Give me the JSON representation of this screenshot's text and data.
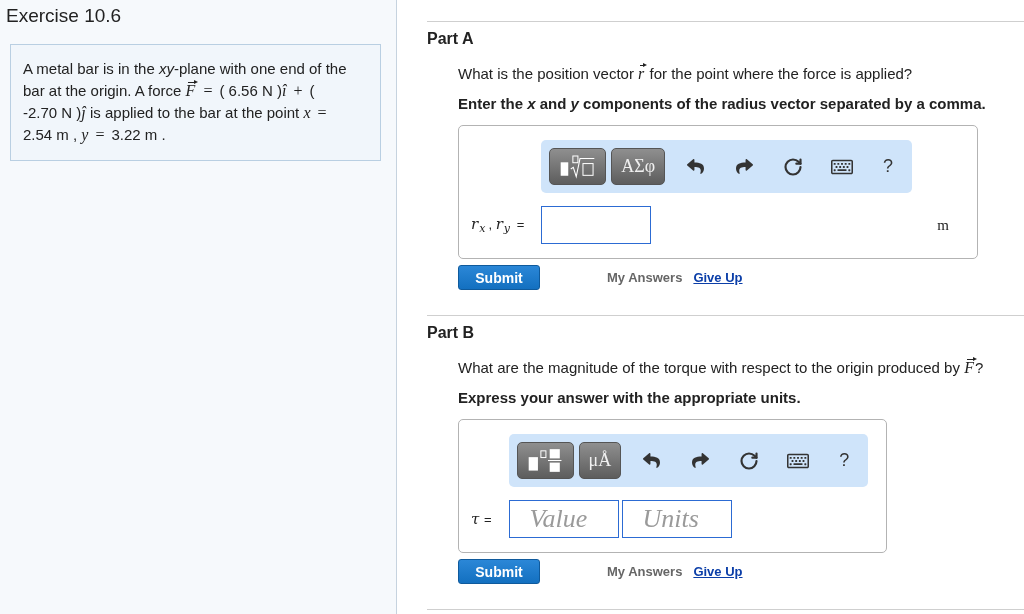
{
  "exercise": {
    "title": "Exercise 10.6",
    "problem": [
      {
        "kind": "text",
        "text": "A metal bar is in the "
      },
      {
        "kind": "italic",
        "text": "xy"
      },
      {
        "kind": "text",
        "text": "-plane with one end of the bar at the origin. A force "
      },
      {
        "kind": "vector",
        "text": "F"
      },
      {
        "kind": "operator",
        "text": " = "
      },
      {
        "kind": "text",
        "text": "( 6.56 N )"
      },
      {
        "kind": "math",
        "text": "î"
      },
      {
        "kind": "operator",
        "text": " + "
      },
      {
        "kind": "text",
        "text": "( -2.70 N )"
      },
      {
        "kind": "math",
        "text": "ĵ"
      },
      {
        "kind": "text",
        "text": " is applied to the bar at the point "
      },
      {
        "kind": "math",
        "text": "x"
      },
      {
        "kind": "operator",
        "text": " = "
      },
      {
        "kind": "text",
        "text": "2.54 m , "
      },
      {
        "kind": "math",
        "text": "y"
      },
      {
        "kind": "operator",
        "text": " = "
      },
      {
        "kind": "text",
        "text": "3.22 m ."
      }
    ]
  },
  "parts": [
    {
      "title": "Part A",
      "question": [
        {
          "kind": "text",
          "text": "What is the position vector "
        },
        {
          "kind": "vector",
          "text": "r"
        },
        {
          "kind": "text",
          "text": " for the point where the force is applied?"
        }
      ],
      "instruction": "Enter the *x* and *y* components of the radius vector separated by a comma.",
      "toolbar": [
        {
          "kind": "root-template"
        },
        {
          "kind": "symbols",
          "label": "ΑΣφ"
        },
        {
          "kind": "undo"
        },
        {
          "kind": "redo"
        },
        {
          "kind": "reset"
        },
        {
          "kind": "keyboard"
        },
        {
          "kind": "help",
          "label": "?"
        }
      ],
      "answer": {
        "label": "*r*$_{x}$, *r*$_{y}$ =",
        "inputs": [
          {
            "kind": "answer"
          }
        ],
        "unit": "m"
      },
      "actions": [
        {
          "kind": "button",
          "label": "Submit",
          "disabled": false
        },
        {
          "kind": "link",
          "label": "My Answers",
          "disabled": true
        },
        {
          "kind": "link",
          "label": "Give Up",
          "disabled": false
        }
      ]
    },
    {
      "title": "Part B",
      "question": [
        {
          "kind": "text",
          "text": "What are the magnitude of the torque with respect to the origin produced by "
        },
        {
          "kind": "vector",
          "text": "F"
        },
        {
          "kind": "text",
          "text": "?"
        }
      ],
      "instruction": "Express your answer with the appropriate units.",
      "toolbar": [
        {
          "kind": "fraction-template"
        },
        {
          "kind": "symbols",
          "label": "μÅ"
        },
        {
          "kind": "undo"
        },
        {
          "kind": "redo"
        },
        {
          "kind": "reset"
        },
        {
          "kind": "keyboard"
        },
        {
          "kind": "help",
          "label": "?"
        }
      ],
      "answer": {
        "label": "*τ* =",
        "inputs": [
          {
            "kind": "answer",
            "placeholder": "Value"
          },
          {
            "kind": "answer",
            "placeholder": "Units"
          }
        ]
      },
      "actions": [
        {
          "kind": "button",
          "label": "Submit",
          "disabled": false
        },
        {
          "kind": "link",
          "label": "My Answers",
          "disabled": true
        },
        {
          "kind": "link",
          "label": "Give Up",
          "disabled": false
        }
      ]
    }
  ]
}
